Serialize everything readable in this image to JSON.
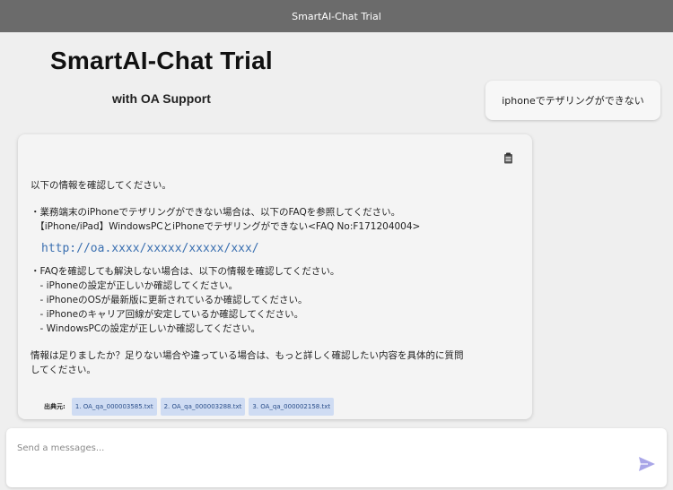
{
  "header": {
    "title": "SmartAI-Chat Trial"
  },
  "brand": {
    "title": "SmartAI-Chat Trial",
    "subtitle": "with OA Support"
  },
  "user_message": {
    "text": "iphoneでテザリングができない"
  },
  "bot_message": {
    "lines": [
      "以下の情報を確認してください。",
      "",
      "・業務端末のiPhoneでテザリングができない場合は、以下のFAQを参照してください。",
      "　【iPhone/iPad】WindowsPCとiPhoneでテザリングができない<FAQ No:F171204004>"
    ],
    "link": "http://oa.xxxx/xxxxx/xxxxx/xxx/",
    "lines2": [
      "・FAQを確認しても解決しない場合は、以下の情報を確認してください。",
      "　- iPhoneの設定が正しいか確認してください。",
      "　- iPhoneのOSが最新版に更新されているか確認してください。",
      "　- iPhoneのキャリア回線が安定しているか確認してください。",
      "　- WindowsPCの設定が正しいか確認してください。"
    ],
    "closing": [
      "情報は足りましたか？足りない場合や違っている場合は、もっと詳しく確認したい内容を具体的に質問",
      "してください。"
    ],
    "sources_label": "出典元:",
    "sources": [
      "1. OA_qa_000003585.txt",
      "2. OA_qa_000003288.txt",
      "3. OA_qa_000002158.txt"
    ]
  },
  "composer": {
    "placeholder": "Send a messages..."
  },
  "icons": {
    "copy": "clipboard-icon",
    "send": "paper-plane-icon"
  },
  "colors": {
    "header_bg": "#6b6b6b",
    "link": "#3a6fb0",
    "source_tag_bg": "#cfdcf3",
    "send_icon": "#a9a6e8"
  }
}
